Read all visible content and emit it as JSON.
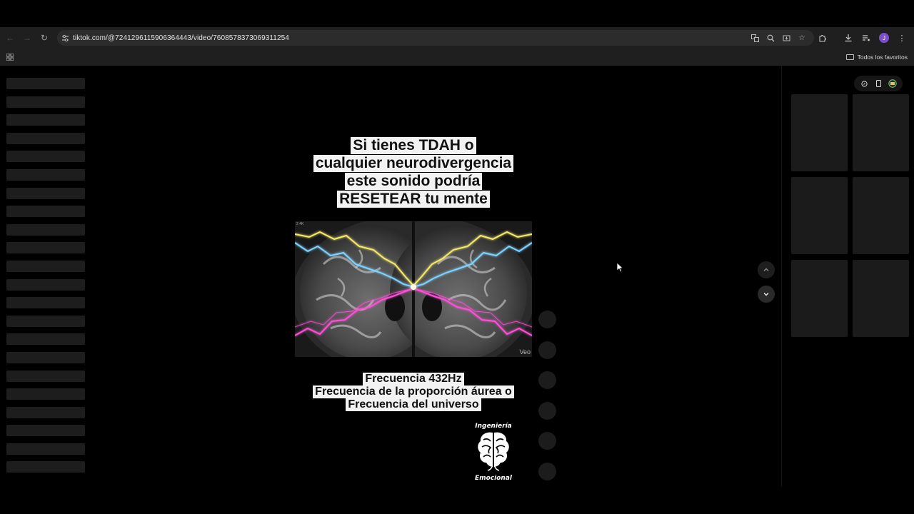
{
  "browser": {
    "url": "tiktok.com/@7241296115906364443/video/7608578373069311254",
    "bookmark_folder": "Todos los favoritos",
    "profile_initial": "J"
  },
  "video": {
    "title_lines": [
      "Si tienes TDAH o",
      "cualquier neurodivergencia",
      "este sonido podría",
      "RESETEAR tu mente"
    ],
    "image_tag": "2 4K",
    "watermark": "Veo",
    "freq_lines": [
      "Frecuencia 432Hz",
      "Frecuencia de la proporción áurea o",
      "Frecuencia del universo"
    ],
    "logo_top": "Ingeniería",
    "logo_bottom": "Emocional"
  },
  "colors": {
    "lightning_yellow": "#f5e96a",
    "lightning_blue": "#7fd3ff",
    "lightning_magenta": "#ff4fd8",
    "profile": "#7b4fc8"
  },
  "icons": {
    "back": "arrow-left-icon",
    "forward": "arrow-right-icon",
    "reload": "reload-icon",
    "site_info": "tune-icon",
    "translate": "translate-icon",
    "zoom": "zoom-icon",
    "install": "install-app-icon",
    "bookmark": "star-icon",
    "extensions": "puzzle-icon",
    "downloads": "download-icon",
    "media": "media-control-icon",
    "menu": "kebab-menu-icon"
  }
}
